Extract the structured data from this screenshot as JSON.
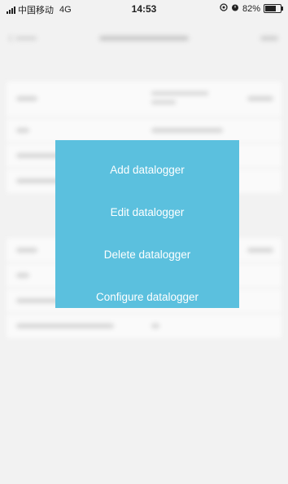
{
  "status_bar": {
    "carrier": "中国移动",
    "network": "4G",
    "time": "14:53",
    "battery_percent": "82%",
    "battery_level": 0.82,
    "icons": [
      "signal-icon",
      "location-icon",
      "alarm-icon",
      "battery-icon"
    ]
  },
  "menu": {
    "background_color": "#5bc0de",
    "text_color": "#ffffff",
    "items": [
      {
        "label": "Add datalogger"
      },
      {
        "label": "Edit datalogger"
      },
      {
        "label": "Delete datalogger"
      },
      {
        "label": "Configure datalogger"
      }
    ]
  }
}
